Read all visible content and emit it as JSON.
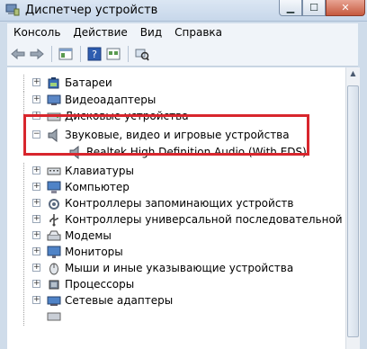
{
  "window": {
    "title": "Диспетчер устройств"
  },
  "menu": [
    "Консоль",
    "Действие",
    "Вид",
    "Справка"
  ],
  "toolbar": {
    "icons": [
      "back-arrow-icon",
      "forward-arrow-icon",
      "properties-icon",
      "help-icon",
      "view-icon",
      "scan-hardware-icon"
    ]
  },
  "tree": {
    "items": [
      {
        "label": "Батареи",
        "icon": "battery-icon",
        "expanded": false,
        "level": 0
      },
      {
        "label": "Видеоадаптеры",
        "icon": "display-adapter-icon",
        "expanded": false,
        "level": 0
      },
      {
        "label": "Дисковые устройства",
        "icon": "disk-drive-icon",
        "expanded": false,
        "level": 0
      },
      {
        "label": "Звуковые, видео и игровые устройства",
        "icon": "sound-icon",
        "expanded": true,
        "level": 0
      },
      {
        "label": "Realtek High Definition Audio (With EDS)",
        "icon": "speaker-icon",
        "expanded": false,
        "level": 1
      },
      {
        "label": "Клавиатуры",
        "icon": "keyboard-icon",
        "expanded": false,
        "level": 0
      },
      {
        "label": "Компьютер",
        "icon": "computer-icon",
        "expanded": false,
        "level": 0
      },
      {
        "label": "Контроллеры запоминающих устройств",
        "icon": "storage-controller-icon",
        "expanded": false,
        "level": 0
      },
      {
        "label": "Контроллеры универсальной последовательной шины U",
        "icon": "usb-icon",
        "expanded": false,
        "level": 0
      },
      {
        "label": "Модемы",
        "icon": "modem-icon",
        "expanded": false,
        "level": 0
      },
      {
        "label": "Мониторы",
        "icon": "monitor-icon",
        "expanded": false,
        "level": 0
      },
      {
        "label": "Мыши и иные указывающие устройства",
        "icon": "mouse-icon",
        "expanded": false,
        "level": 0
      },
      {
        "label": "Процессоры",
        "icon": "processor-icon",
        "expanded": false,
        "level": 0
      },
      {
        "label": "Сетевые адаптеры",
        "icon": "network-adapter-icon",
        "expanded": false,
        "level": 0
      }
    ]
  },
  "colors": {
    "highlight": "#d8262d",
    "chrome": "#cfdcea"
  }
}
